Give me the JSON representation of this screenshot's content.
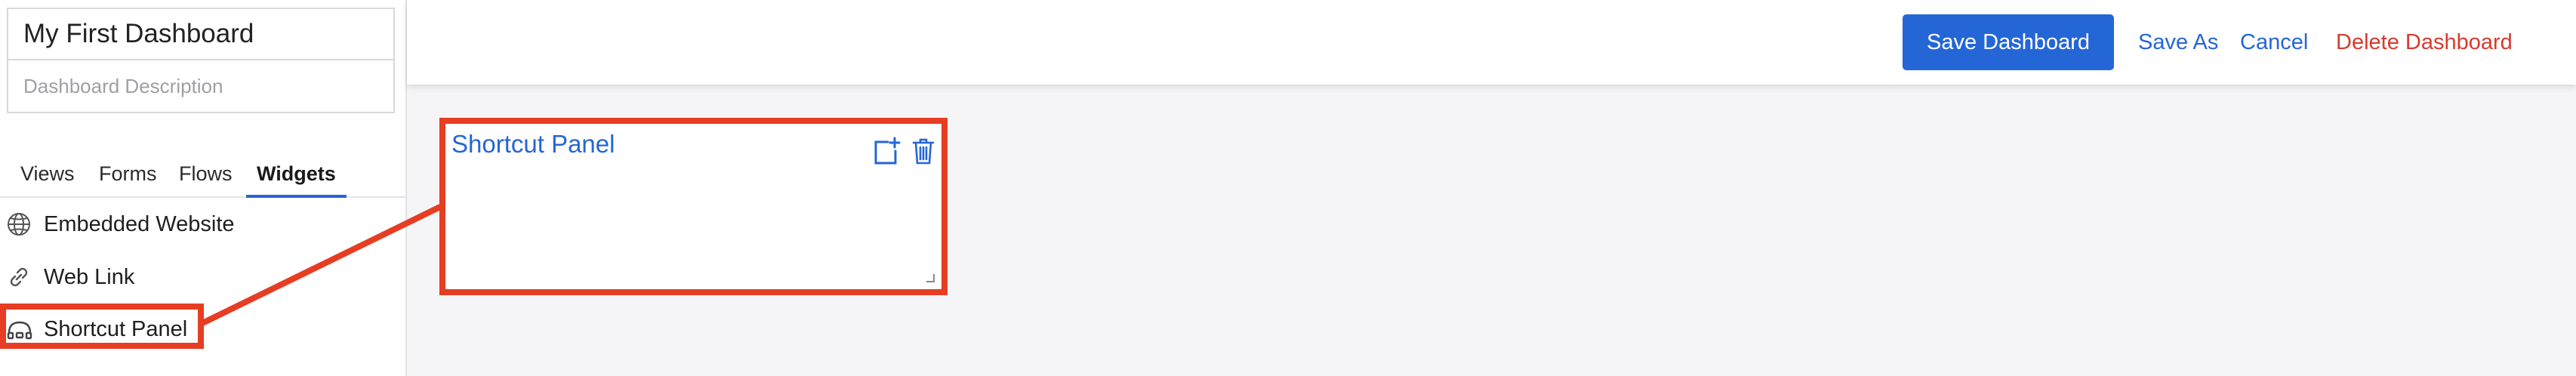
{
  "sidebar": {
    "title_value": "My First Dashboard",
    "description_placeholder": "Dashboard Description",
    "tabs": [
      {
        "label": "Views"
      },
      {
        "label": "Forms"
      },
      {
        "label": "Flows"
      },
      {
        "label": "Widgets",
        "active": true
      }
    ],
    "widgets": [
      {
        "label": "Embedded Website",
        "icon": "globe-icon"
      },
      {
        "label": "Web Link",
        "icon": "link-icon"
      },
      {
        "label": "Shortcut Panel",
        "icon": "shortcut-panel-icon"
      }
    ]
  },
  "header": {
    "save_label": "Save Dashboard",
    "save_as_label": "Save As",
    "cancel_label": "Cancel",
    "delete_label": "Delete Dashboard"
  },
  "panel": {
    "title": "Shortcut Panel",
    "add_icon": "add-shortcut-icon",
    "delete_icon": "trash-icon"
  },
  "colors": {
    "accent": "#2566d6",
    "danger": "#d83a2e",
    "annotation": "#e63d23"
  }
}
